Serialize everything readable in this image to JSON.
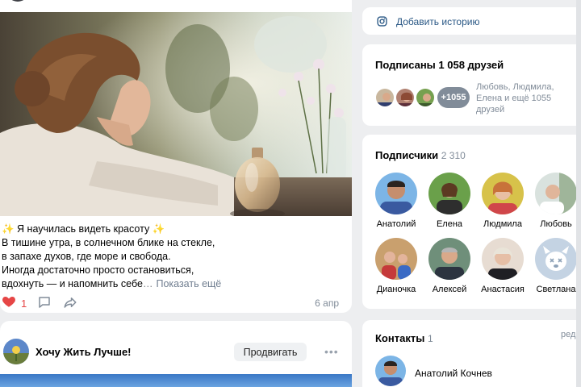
{
  "post": {
    "line1": "✨ Я научилась видеть красоту ✨",
    "line2": "В тишине утра, в солнечном блике на стекле,",
    "line3": "в запахе духов, где море и свобода.",
    "line4": "Иногда достаточно просто остановиться,",
    "line5": "вдохнуть — и напомнить себе",
    "show_more": "Показать ещё",
    "likes": "1",
    "date": "6 апр"
  },
  "group_post": {
    "name": "Хочу Жить Лучше!",
    "promote_label": "Продвигать",
    "more": "•••"
  },
  "story": {
    "label": "Добавить историю"
  },
  "friends": {
    "title": "Подписаны 1 058 друзей",
    "more_badge": "+1055",
    "names_text": "Любовь, Людмила, Елена и ещё 1055 друзей"
  },
  "followers": {
    "title": "Подписчики",
    "count": "2 310",
    "items": [
      {
        "name": "Анатолий"
      },
      {
        "name": "Елена"
      },
      {
        "name": "Людмила"
      },
      {
        "name": "Любовь"
      },
      {
        "name": "Дианочка"
      },
      {
        "name": "Алексей"
      },
      {
        "name": "Анастасия"
      },
      {
        "name": "Светлана"
      }
    ]
  },
  "contacts": {
    "title": "Контакты",
    "count": "1",
    "edit": "ред.",
    "items": [
      {
        "name": "Анатолий Кочнев"
      }
    ]
  },
  "colors": {
    "accent_link": "#2a5885",
    "like_red": "#e64646",
    "muted": "#818c99",
    "page_bg": "#edeef0"
  },
  "icons": [
    "instagram-icon",
    "heart-icon",
    "comment-icon",
    "share-icon",
    "more-icon"
  ]
}
